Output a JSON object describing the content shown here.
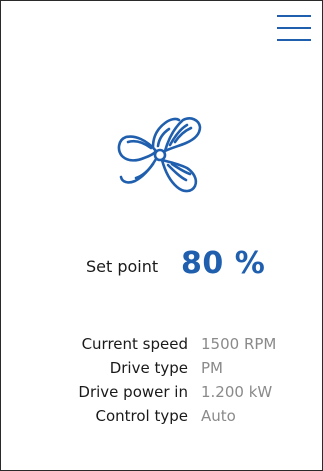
{
  "header": {
    "menu_icon": "hamburger-menu-icon"
  },
  "fan": {
    "icon": "fan-icon",
    "color": "#1f5fae"
  },
  "setpoint": {
    "label": "Set point",
    "value": "80 %"
  },
  "info": [
    {
      "label": "Current speed",
      "value": "1500 RPM"
    },
    {
      "label": "Drive type",
      "value": "PM"
    },
    {
      "label": "Drive power in",
      "value": "1.200 kW"
    },
    {
      "label": "Control type",
      "value": "Auto"
    }
  ],
  "colors": {
    "accent": "#1f5fae",
    "value_text": "#8a8a8a",
    "label_text": "#1a1a1a"
  }
}
